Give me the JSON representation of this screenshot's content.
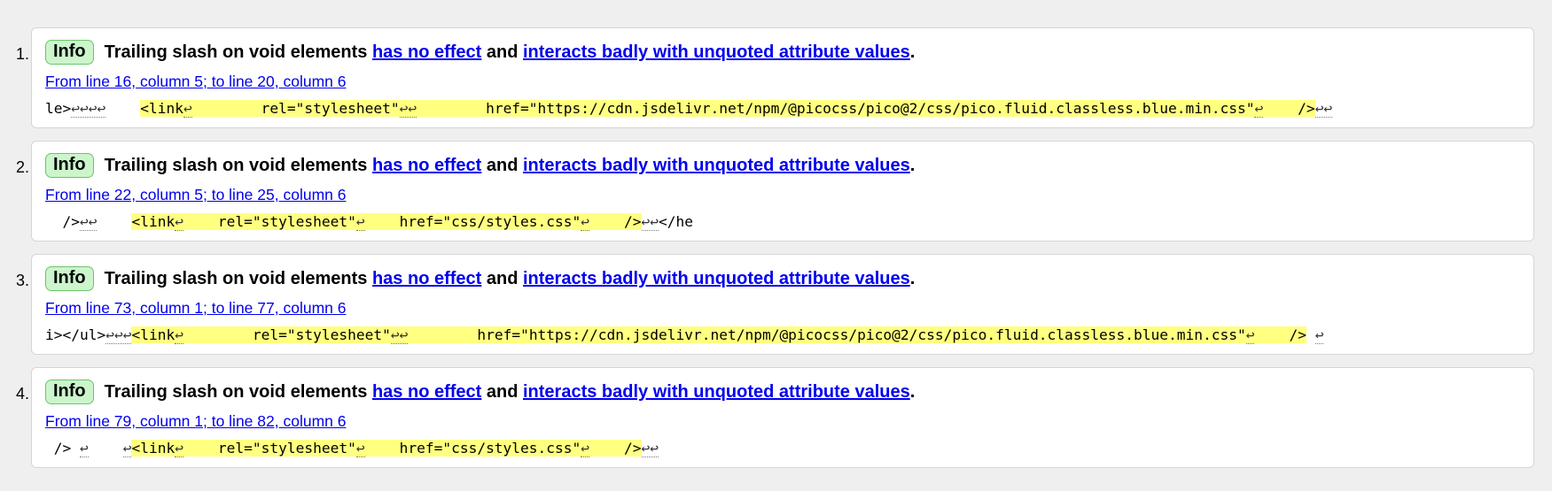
{
  "messages": [
    {
      "number": "1.",
      "type": "Info",
      "title_parts": [
        "Trailing slash on void elements ",
        "has no effect",
        " and ",
        "interacts badly with unquoted attribute values",
        "."
      ],
      "location": "From line 16, column 5; to line 20, column 6",
      "extract": [
        {
          "t": "le>",
          "k": "txt"
        },
        {
          "t": "↩↩↩↩",
          "k": "lf"
        },
        {
          "t": "    ",
          "k": "txt"
        },
        {
          "t": "<link",
          "k": "hl"
        },
        {
          "t": "↩",
          "k": "hllf"
        },
        {
          "t": "        rel=\"stylesheet\"",
          "k": "hl"
        },
        {
          "t": "↩↩",
          "k": "hllf"
        },
        {
          "t": "        href=\"https://cdn.jsdelivr.net/npm/@picocss/pico@2/css/pico.fluid.classless.blue.min.css\"",
          "k": "hl"
        },
        {
          "t": "↩",
          "k": "hllf"
        },
        {
          "t": "    />",
          "k": "hl"
        },
        {
          "t": "↩↩",
          "k": "lf"
        }
      ]
    },
    {
      "number": "2.",
      "type": "Info",
      "title_parts": [
        "Trailing slash on void elements ",
        "has no effect",
        " and ",
        "interacts badly with unquoted attribute values",
        "."
      ],
      "location": "From line 22, column 5; to line 25, column 6",
      "extract": [
        {
          "t": "  />",
          "k": "txt"
        },
        {
          "t": "↩↩",
          "k": "lf"
        },
        {
          "t": "    ",
          "k": "txt"
        },
        {
          "t": "<link",
          "k": "hl"
        },
        {
          "t": "↩",
          "k": "hllf"
        },
        {
          "t": "    rel=\"stylesheet\"",
          "k": "hl"
        },
        {
          "t": "↩",
          "k": "hllf"
        },
        {
          "t": "    href=\"css/styles.css\"",
          "k": "hl"
        },
        {
          "t": "↩",
          "k": "hllf"
        },
        {
          "t": "    />",
          "k": "hl"
        },
        {
          "t": "↩↩",
          "k": "lf"
        },
        {
          "t": "</he",
          "k": "txt"
        }
      ]
    },
    {
      "number": "3.",
      "type": "Info",
      "title_parts": [
        "Trailing slash on void elements ",
        "has no effect",
        " and ",
        "interacts badly with unquoted attribute values",
        "."
      ],
      "location": "From line 73, column 1; to line 77, column 6",
      "extract": [
        {
          "t": "i></ul>",
          "k": "txt"
        },
        {
          "t": "↩↩↩",
          "k": "lf"
        },
        {
          "t": "<link",
          "k": "hl"
        },
        {
          "t": "↩",
          "k": "hllf"
        },
        {
          "t": "        rel=\"stylesheet\"",
          "k": "hl"
        },
        {
          "t": "↩↩",
          "k": "hllf"
        },
        {
          "t": "        href=\"https://cdn.jsdelivr.net/npm/@picocss/pico@2/css/pico.fluid.classless.blue.min.css\"",
          "k": "hl"
        },
        {
          "t": "↩",
          "k": "hllf"
        },
        {
          "t": "    />",
          "k": "hl"
        },
        {
          "t": " ",
          "k": "txt"
        },
        {
          "t": "↩",
          "k": "lf"
        }
      ]
    },
    {
      "number": "4.",
      "type": "Info",
      "title_parts": [
        "Trailing slash on void elements ",
        "has no effect",
        " and ",
        "interacts badly with unquoted attribute values",
        "."
      ],
      "location": "From line 79, column 1; to line 82, column 6",
      "extract": [
        {
          "t": " /> ",
          "k": "txt"
        },
        {
          "t": "↩",
          "k": "lf"
        },
        {
          "t": "    ",
          "k": "txt"
        },
        {
          "t": "↩",
          "k": "lf"
        },
        {
          "t": "<link",
          "k": "hl"
        },
        {
          "t": "↩",
          "k": "hllf"
        },
        {
          "t": "    rel=\"stylesheet\"",
          "k": "hl"
        },
        {
          "t": "↩",
          "k": "hllf"
        },
        {
          "t": "    href=\"css/styles.css\"",
          "k": "hl"
        },
        {
          "t": "↩",
          "k": "hllf"
        },
        {
          "t": "    />",
          "k": "hl"
        },
        {
          "t": "↩↩",
          "k": "lf"
        }
      ]
    }
  ]
}
